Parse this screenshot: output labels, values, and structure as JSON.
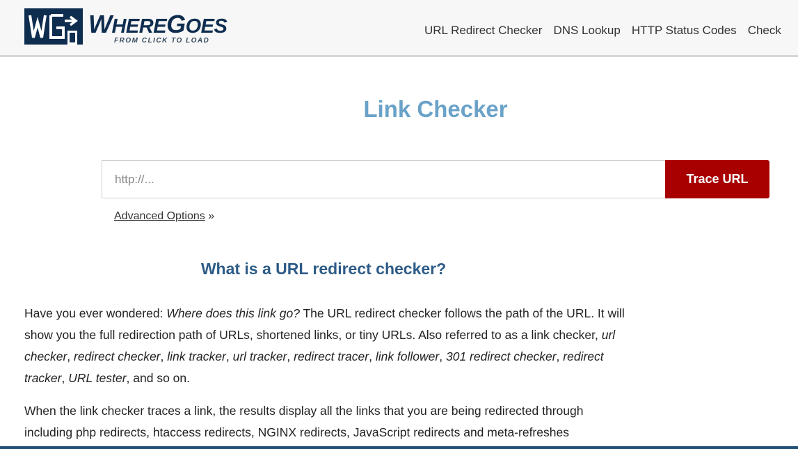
{
  "colors": {
    "brand_navy": "#0f2d4f",
    "title_blue": "#6aa2c8",
    "section_blue": "#2e5c87",
    "button_red": "#a80000"
  },
  "header": {
    "logo": {
      "word_first_cap": "W",
      "word_first_rest": "HERE",
      "word_second_cap": "G",
      "word_second_rest": "OES",
      "tagline": "FROM CLICK TO LOAD",
      "mark_icon": "wheregoes-logo-mark"
    },
    "nav": [
      "URL Redirect Checker",
      "DNS Lookup",
      "HTTP Status Codes",
      "Check"
    ]
  },
  "main": {
    "title": "Link Checker",
    "search": {
      "placeholder": "http://...",
      "value": "",
      "button_label": "Trace URL"
    },
    "advanced_options_label": "Advanced Options",
    "advanced_options_arrow": "»",
    "section_heading": "What is a URL redirect checker?",
    "para1": {
      "t1": "Have you ever wondered: ",
      "i1": "Where does this link go?",
      "t2": " The URL redirect checker follows the path of the URL. It will show you the full redirection path of URLs, shortened links, or tiny URLs. Also referred to as a link checker, ",
      "i2": "url checker",
      "s2": ", ",
      "i3": "redirect checker",
      "s3": ", ",
      "i4": "link tracker",
      "s4": ", ",
      "i5": "url tracker",
      "s5": ", ",
      "i6": "redirect tracer",
      "s6": ", ",
      "i7": "link follower",
      "s7": ", ",
      "i8": "301 redirect checker",
      "s8": ", ",
      "i9": "redirect tracker",
      "s9": ", ",
      "i10": "URL tester",
      "t3": ", and so on."
    },
    "para2": "When the link checker traces a link, the results display all the links that you are being redirected through including php redirects, htaccess redirects, NGINX redirects, JavaScript redirects and meta-refreshes"
  }
}
